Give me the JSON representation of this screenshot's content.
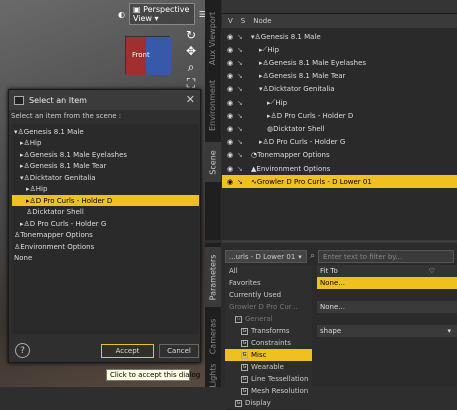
{
  "viewport": {
    "camera_label": "Perspective View",
    "cube_label": "Front"
  },
  "left_tabs": [
    "Aux Viewport",
    "Environment",
    "Scene"
  ],
  "right_tabs": [
    "Parameters",
    "Cameras",
    "Lights"
  ],
  "scene": {
    "header": [
      "V",
      "S",
      "Node"
    ],
    "rows": [
      {
        "indent": 0,
        "label": "Genesis 8.1 Male",
        "icon": "figure-icon",
        "arrow": "▾"
      },
      {
        "indent": 1,
        "label": "Hip",
        "icon": "bone-icon",
        "arrow": "▸"
      },
      {
        "indent": 1,
        "label": "Genesis 8.1 Male Eyelashes",
        "icon": "figure-icon",
        "arrow": "▸"
      },
      {
        "indent": 1,
        "label": "Genesis 8.1 Male Tear",
        "icon": "figure-icon",
        "arrow": "▸"
      },
      {
        "indent": 1,
        "label": "Dicktator Genitalia",
        "icon": "figure-icon",
        "arrow": "▾"
      },
      {
        "indent": 2,
        "label": "Hip",
        "icon": "bone-icon",
        "arrow": "▸"
      },
      {
        "indent": 2,
        "label": "D Pro Curls - Holder D",
        "icon": "figure-icon",
        "arrow": "▸"
      },
      {
        "indent": 2,
        "label": "Dicktator Shell",
        "icon": "shell-icon",
        "arrow": ""
      },
      {
        "indent": 1,
        "label": "D Pro Curls - Holder G",
        "icon": "figure-icon",
        "arrow": "▸"
      },
      {
        "indent": 0,
        "label": "Tonemapper Options",
        "icon": "tonemapper-icon",
        "arrow": ""
      },
      {
        "indent": 0,
        "label": "Environment Options",
        "icon": "environment-icon",
        "arrow": ""
      },
      {
        "indent": 0,
        "label": "Growler D Pro Curls - D Lower 01",
        "icon": "hair-icon",
        "arrow": "",
        "selected": true
      }
    ]
  },
  "params": {
    "node_select": "...urls - D Lower 01",
    "filter_placeholder": "Enter text to filter by...",
    "groups": [
      {
        "label": "All",
        "level": 0
      },
      {
        "label": "Favorites",
        "level": 0
      },
      {
        "label": "Currently Used",
        "level": 0
      },
      {
        "label": "Growler D Pro Cur...",
        "level": 0,
        "dim": true
      },
      {
        "label": "General",
        "level": 1,
        "dim": true
      },
      {
        "label": "Transforms",
        "level": 2
      },
      {
        "label": "Constraints",
        "level": 2
      },
      {
        "label": "Misc",
        "level": 2,
        "selected": true
      },
      {
        "label": "Wearable",
        "level": 2
      },
      {
        "label": "Line Tessellation",
        "level": 2
      },
      {
        "label": "Mesh Resolution",
        "level": 2
      },
      {
        "label": "Display",
        "level": 1
      }
    ],
    "fit_to_label": "Fit To",
    "fit_to_value": "None...",
    "row2_value": "None...",
    "shape_value": "shape"
  },
  "dialog": {
    "title": "Select an Item",
    "subtitle": "Select an item from the scene :",
    "items": [
      {
        "indent": 0,
        "label": "Genesis 8.1 Male",
        "arrow": "▾"
      },
      {
        "indent": 1,
        "label": "Hip",
        "arrow": "▸"
      },
      {
        "indent": 1,
        "label": "Genesis 8.1 Male Eyelashes",
        "arrow": "▸"
      },
      {
        "indent": 1,
        "label": "Genesis 8.1 Male Tear",
        "arrow": "▸"
      },
      {
        "indent": 1,
        "label": "Dicktator Genitalia",
        "arrow": "▾"
      },
      {
        "indent": 2,
        "label": "Hip",
        "arrow": "▸"
      },
      {
        "indent": 2,
        "label": "D Pro Curls - Holder D",
        "arrow": "▸",
        "selected": true
      },
      {
        "indent": 2,
        "label": "Dicktator Shell",
        "arrow": ""
      },
      {
        "indent": 1,
        "label": "D Pro Curls - Holder G",
        "arrow": "▸"
      },
      {
        "indent": 0,
        "label": "Tonemapper Options",
        "arrow": ""
      },
      {
        "indent": 0,
        "label": "Environment Options",
        "arrow": ""
      },
      {
        "indent": 0,
        "label": "None",
        "arrow": ""
      }
    ],
    "help_label": "?",
    "accept_label": "Accept",
    "cancel_label": "Cancel",
    "tooltip": "Click to accept this dialog"
  }
}
